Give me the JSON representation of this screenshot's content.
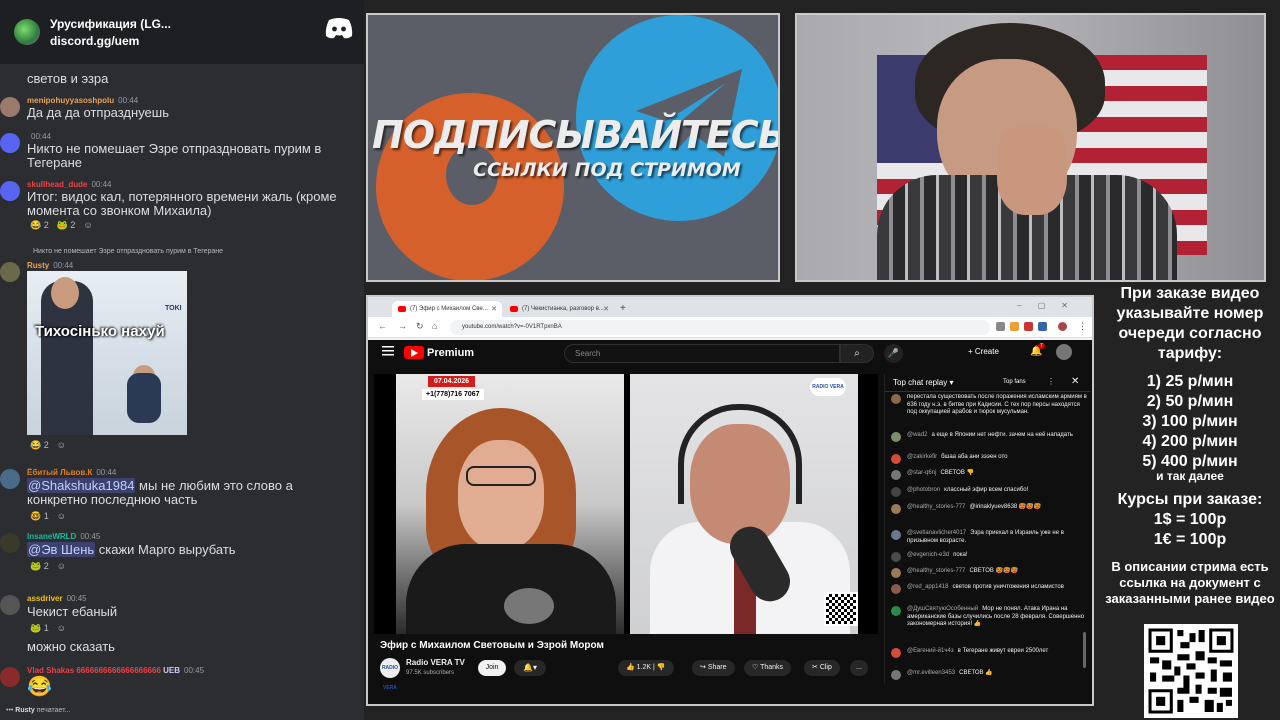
{
  "discord": {
    "server_title": "Урусификация (LG...",
    "invite": "discord.gg/uem",
    "messages": [
      {
        "text": "светов и эзра"
      },
      {
        "author": "menipohuyyasoshpolu",
        "time": "00:44",
        "text": "Да да да отпразднуешь"
      },
      {
        "author": "",
        "time": "00:44",
        "text": "Никто не помешает Эзре отпраздновать пурим в Тегеране"
      },
      {
        "author": "skullhead_dude",
        "time": "00:44",
        "text": "Итог: видос кал, потерянного времени жаль (кроме момента со звонком Михаила)",
        "reactions": [
          "😂 2",
          "🐸 2",
          "☺"
        ]
      },
      {
        "reply": "Никто не помешает Эзре отпраздновать пурим в Тегеране",
        "author": "Rusty",
        "time": "00:44",
        "embed_caption": "Тихосінько нахуй",
        "embed_logo": "TOKI",
        "reactions": [
          "😂 2",
          "☺"
        ]
      },
      {
        "author": "Ёбитый Львов.К",
        "time": "00:44",
        "mention": "@Shakshuka1984",
        "text": " мы не любим это слово а конкретно последнюю часть",
        "reactions": [
          "🤓 1",
          "☺"
        ]
      },
      {
        "author": "InsaneWRLD",
        "time": "00:45",
        "mention": "@Эв Шень",
        "text": " скажи Марго вырубать",
        "reactions": [
          "🐸 2",
          "☺"
        ]
      },
      {
        "author": "assdriver",
        "time": "00:45",
        "text": "Чекист ебаный",
        "text2": "можно сказать",
        "reactions": [
          "🐸 1",
          "☺"
        ]
      },
      {
        "author": "Vlad Shakas 6666666666666666666",
        "tag": "UEB",
        "time": "00:45",
        "emoji": "😂"
      }
    ],
    "typing_user": "Rusty",
    "typing_text": "печатает..."
  },
  "banner": {
    "title": "ПОДПИСЫВАЙТЕСЬ",
    "subtitle": "ССЫЛКИ ПОД СТРИМОМ"
  },
  "browser": {
    "tabs": [
      {
        "label": "(7) Эфир с Михаилом Све..."
      },
      {
        "label": "(7) Чекистианка, разговор в..."
      }
    ],
    "url": "youtube.com/watch?v=-0V1RTpxnBA"
  },
  "youtube": {
    "brand": "Premium",
    "search_placeholder": "Search",
    "create_label": "Create",
    "bell_count": "7",
    "video": {
      "date": "07.04.2026",
      "phone": "+1(778)716 7067",
      "title": "Эфир с Михаилом Световым и Эзрой Мором",
      "logo": "RADIO VERA",
      "channel": "Radio VERA TV",
      "subscribers": "97.5K subscribers",
      "join": "Join",
      "likes": "1.2K",
      "share": "Share",
      "thanks": "Thanks",
      "clip": "Clip",
      "more": "..."
    },
    "chat": {
      "mode": "Top chat replay",
      "top_fans": "Top fans",
      "messages": [
        {
          "author": "",
          "text": "перестала существовать после поражения исламским армиям в 636 году н.э. в битве при Кадисии. С тех пор персы находятся под оккупацией арабов и тюрок мусульман.",
          "color": "#8a6a4a"
        },
        {
          "author": "@wad2",
          "text": "а еще в Японии нет нефти. зачем на неё нападать",
          "color": "#7a8f6a"
        },
        {
          "author": "@zakirkefir",
          "text": "бшаа аба ани зээен ото",
          "color": "#d34c3a"
        },
        {
          "author": "@star-q6nj",
          "text": "СВЕТОВ 👎",
          "color": "#777"
        },
        {
          "author": "@photobron",
          "text": "классный эфир всем спасибо!",
          "color": "#444"
        },
        {
          "author": "@healthy_stories-777",
          "text": "@irinaklyuev8638 🥵🥵🥵",
          "color": "#9a7a5a"
        },
        {
          "author": "@svetlanavlicher4017",
          "text": "Эзра приехал в Израиль уже не в призывном возрасте.",
          "color": "#6a7a8a"
        },
        {
          "author": "@evgenich-e3d",
          "text": "пока!",
          "color": "#4a4a4a"
        },
        {
          "author": "@healthy_stories-777",
          "text": "СВЕТОВ 🥵🥵🥵",
          "color": "#9a7a5a"
        },
        {
          "author": "@red_app1418",
          "text": "светов против уничтожения исламистов",
          "color": "#8a5a4a"
        },
        {
          "author": "@ДушСвятуюОсобенный",
          "text": "Мор не понял. Атака Ирана на американские базы случились после 28 февраля. Совершенно закономерная история! 👍",
          "color": "#2a8a4a"
        },
        {
          "author": "@Евгений-й1ч4з",
          "text": "в Тегеране живут евреи 2500лет",
          "color": "#d34c3a"
        },
        {
          "author": "@mr.evilleen3453",
          "text": "СВЕТОВ 👍",
          "color": "#777"
        }
      ]
    }
  },
  "info": {
    "header": "При заказе видео указывайте номер очереди согласно тарифу:",
    "tariffs": [
      "1) 25 р/мин",
      "2) 50 р/мин",
      "3) 100 р/мин",
      "4) 200 р/мин",
      "5) 400 р/мин"
    ],
    "etc": "и так далее",
    "courses_title": "Курсы при заказе:",
    "course1": "1$ = 100р",
    "course2": "1€ = 100р",
    "desc": "В описании стрима есть ссылка на документ с заказанными ранее видео"
  },
  "colors": {
    "discord_bg": "#2b2d31",
    "yt_bg": "#0f0f0f",
    "telegram_blue": "#2f9fd9",
    "boosty_orange": "#d5602c",
    "live_red": "#d31c1c"
  }
}
